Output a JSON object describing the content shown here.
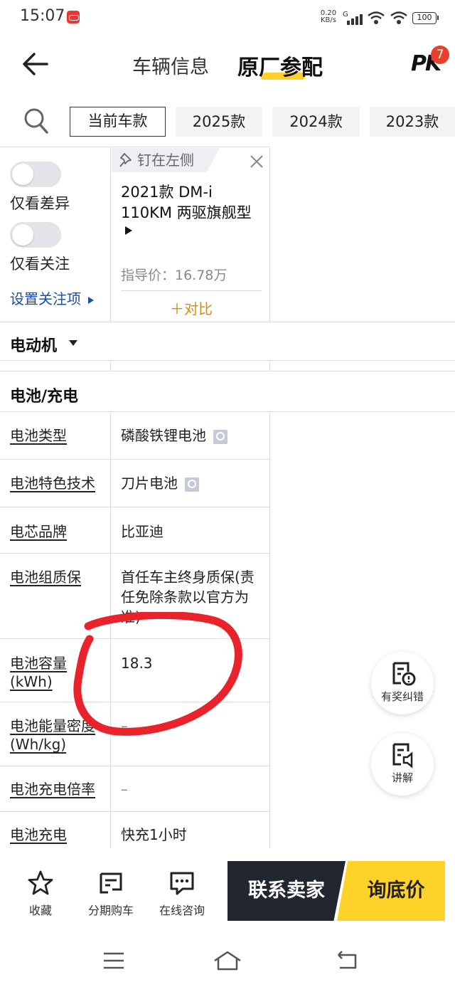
{
  "status": {
    "time": "15:07",
    "speed_value": "0.20",
    "speed_unit": "KB/s",
    "network": "G",
    "battery": "100"
  },
  "header": {
    "tab_info": "车辆信息",
    "tab_config": "原厂参配",
    "pk_label": "PK",
    "pk_badge": "7"
  },
  "years": [
    "当前车款",
    "2025款",
    "2024款",
    "2023款"
  ],
  "filters": {
    "diff_only": "仅看差异",
    "focus_only": "仅看关注",
    "set_focus": "设置关注项"
  },
  "car": {
    "pin_label": "钉在左侧",
    "name": "2021款 DM-i 110KM 两驱旗舰型",
    "price": "指导价：16.78万",
    "compare": "＋对比"
  },
  "sections": {
    "motor": "电动机",
    "battery": "电池/充电"
  },
  "rows": [
    {
      "label": "电池类型",
      "value": "磷酸铁锂电池"
    },
    {
      "label": "电池特色技术",
      "value": "刀片电池"
    },
    {
      "label": "电芯品牌",
      "value": "比亚迪"
    },
    {
      "label": "电池组质保",
      "value": "首任车主终身质保(责任免除条款以官方为准)"
    },
    {
      "label": "电池容量(kWh)",
      "value": "18.3"
    },
    {
      "label": "电池能量密度(Wh/kg)",
      "value": "–"
    },
    {
      "label": "电池充电倍率",
      "value": "–"
    },
    {
      "label": "电池充电",
      "value": "快充1小时"
    }
  ],
  "fabs": {
    "report": "有奖纠错",
    "explain": "讲解"
  },
  "bottom": {
    "favorite": "收藏",
    "installment": "分期购车",
    "consult": "在线咨询",
    "contact": "联系卖家",
    "ask_price": "询底价"
  },
  "colors": {
    "accent_yellow": "#ffd22a",
    "dark_button": "#22262e",
    "link_blue": "#1b4fa3",
    "badge_red": "#e8402a",
    "annotation_red": "#e8232b"
  }
}
